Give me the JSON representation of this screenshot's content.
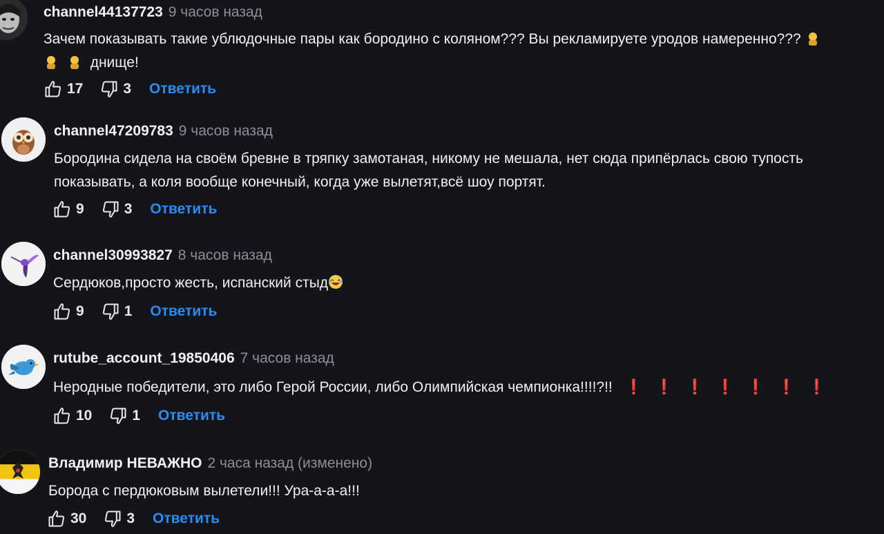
{
  "comments": [
    {
      "username": "channel44137723",
      "timestamp": "9 часов назад",
      "text_line1": "Зачем показывать такие ублюдочные пары как бородино с коляном??? Вы рекламируете  уродов намеренно???",
      "text_line2": "днище!",
      "likes": "17",
      "dislikes": "3",
      "reply_label": "Ответить",
      "avatar_icon": "joker-avatar-icon"
    },
    {
      "username": "channel47209783",
      "timestamp": "9 часов назад",
      "text_line1": "Бородина сидела на своём бревне в тряпку замотаная, никому не мешала, нет сюда припёрлась свою тупость",
      "text_line2": "показывать, а коля вообще конечный, когда уже вылетят,всё шоу портят.",
      "likes": "9",
      "dislikes": "3",
      "reply_label": "Ответить",
      "avatar_icon": "owl-avatar-icon"
    },
    {
      "username": "channel30993827",
      "timestamp": "8 часов назад",
      "text_line1": "Сердюков,просто жесть, испанский стыд",
      "likes": "9",
      "dislikes": "1",
      "reply_label": "Ответить",
      "avatar_icon": "hummingbird-avatar-icon"
    },
    {
      "username": "rutube_account_19850406",
      "timestamp": "7 часов назад",
      "text_line1": "Неродные победители, это либо Герой России, либо Олимпийская чемпионка!!!!?!!",
      "exclamations": [
        "❗",
        "❗",
        "❗",
        "❗",
        "❗",
        "❗",
        "❗"
      ],
      "likes": "10",
      "dislikes": "1",
      "reply_label": "Ответить",
      "avatar_icon": "bird-avatar-icon"
    },
    {
      "username": "Владимир НЕВАЖНО",
      "timestamp": "2 часа назад (изменено)",
      "text_line1": "Борода с пердюковым вылетели!!! Ура-а-а-а!!!",
      "likes": "30",
      "dislikes": "3",
      "reply_label": "Ответить",
      "avatar_icon": "imperial-flag-avatar-icon"
    }
  ],
  "colors": {
    "background": "#14151a",
    "reply": "#2a8cf2",
    "timestamp": "#8b8f99",
    "exclamation": "#e0243b"
  }
}
